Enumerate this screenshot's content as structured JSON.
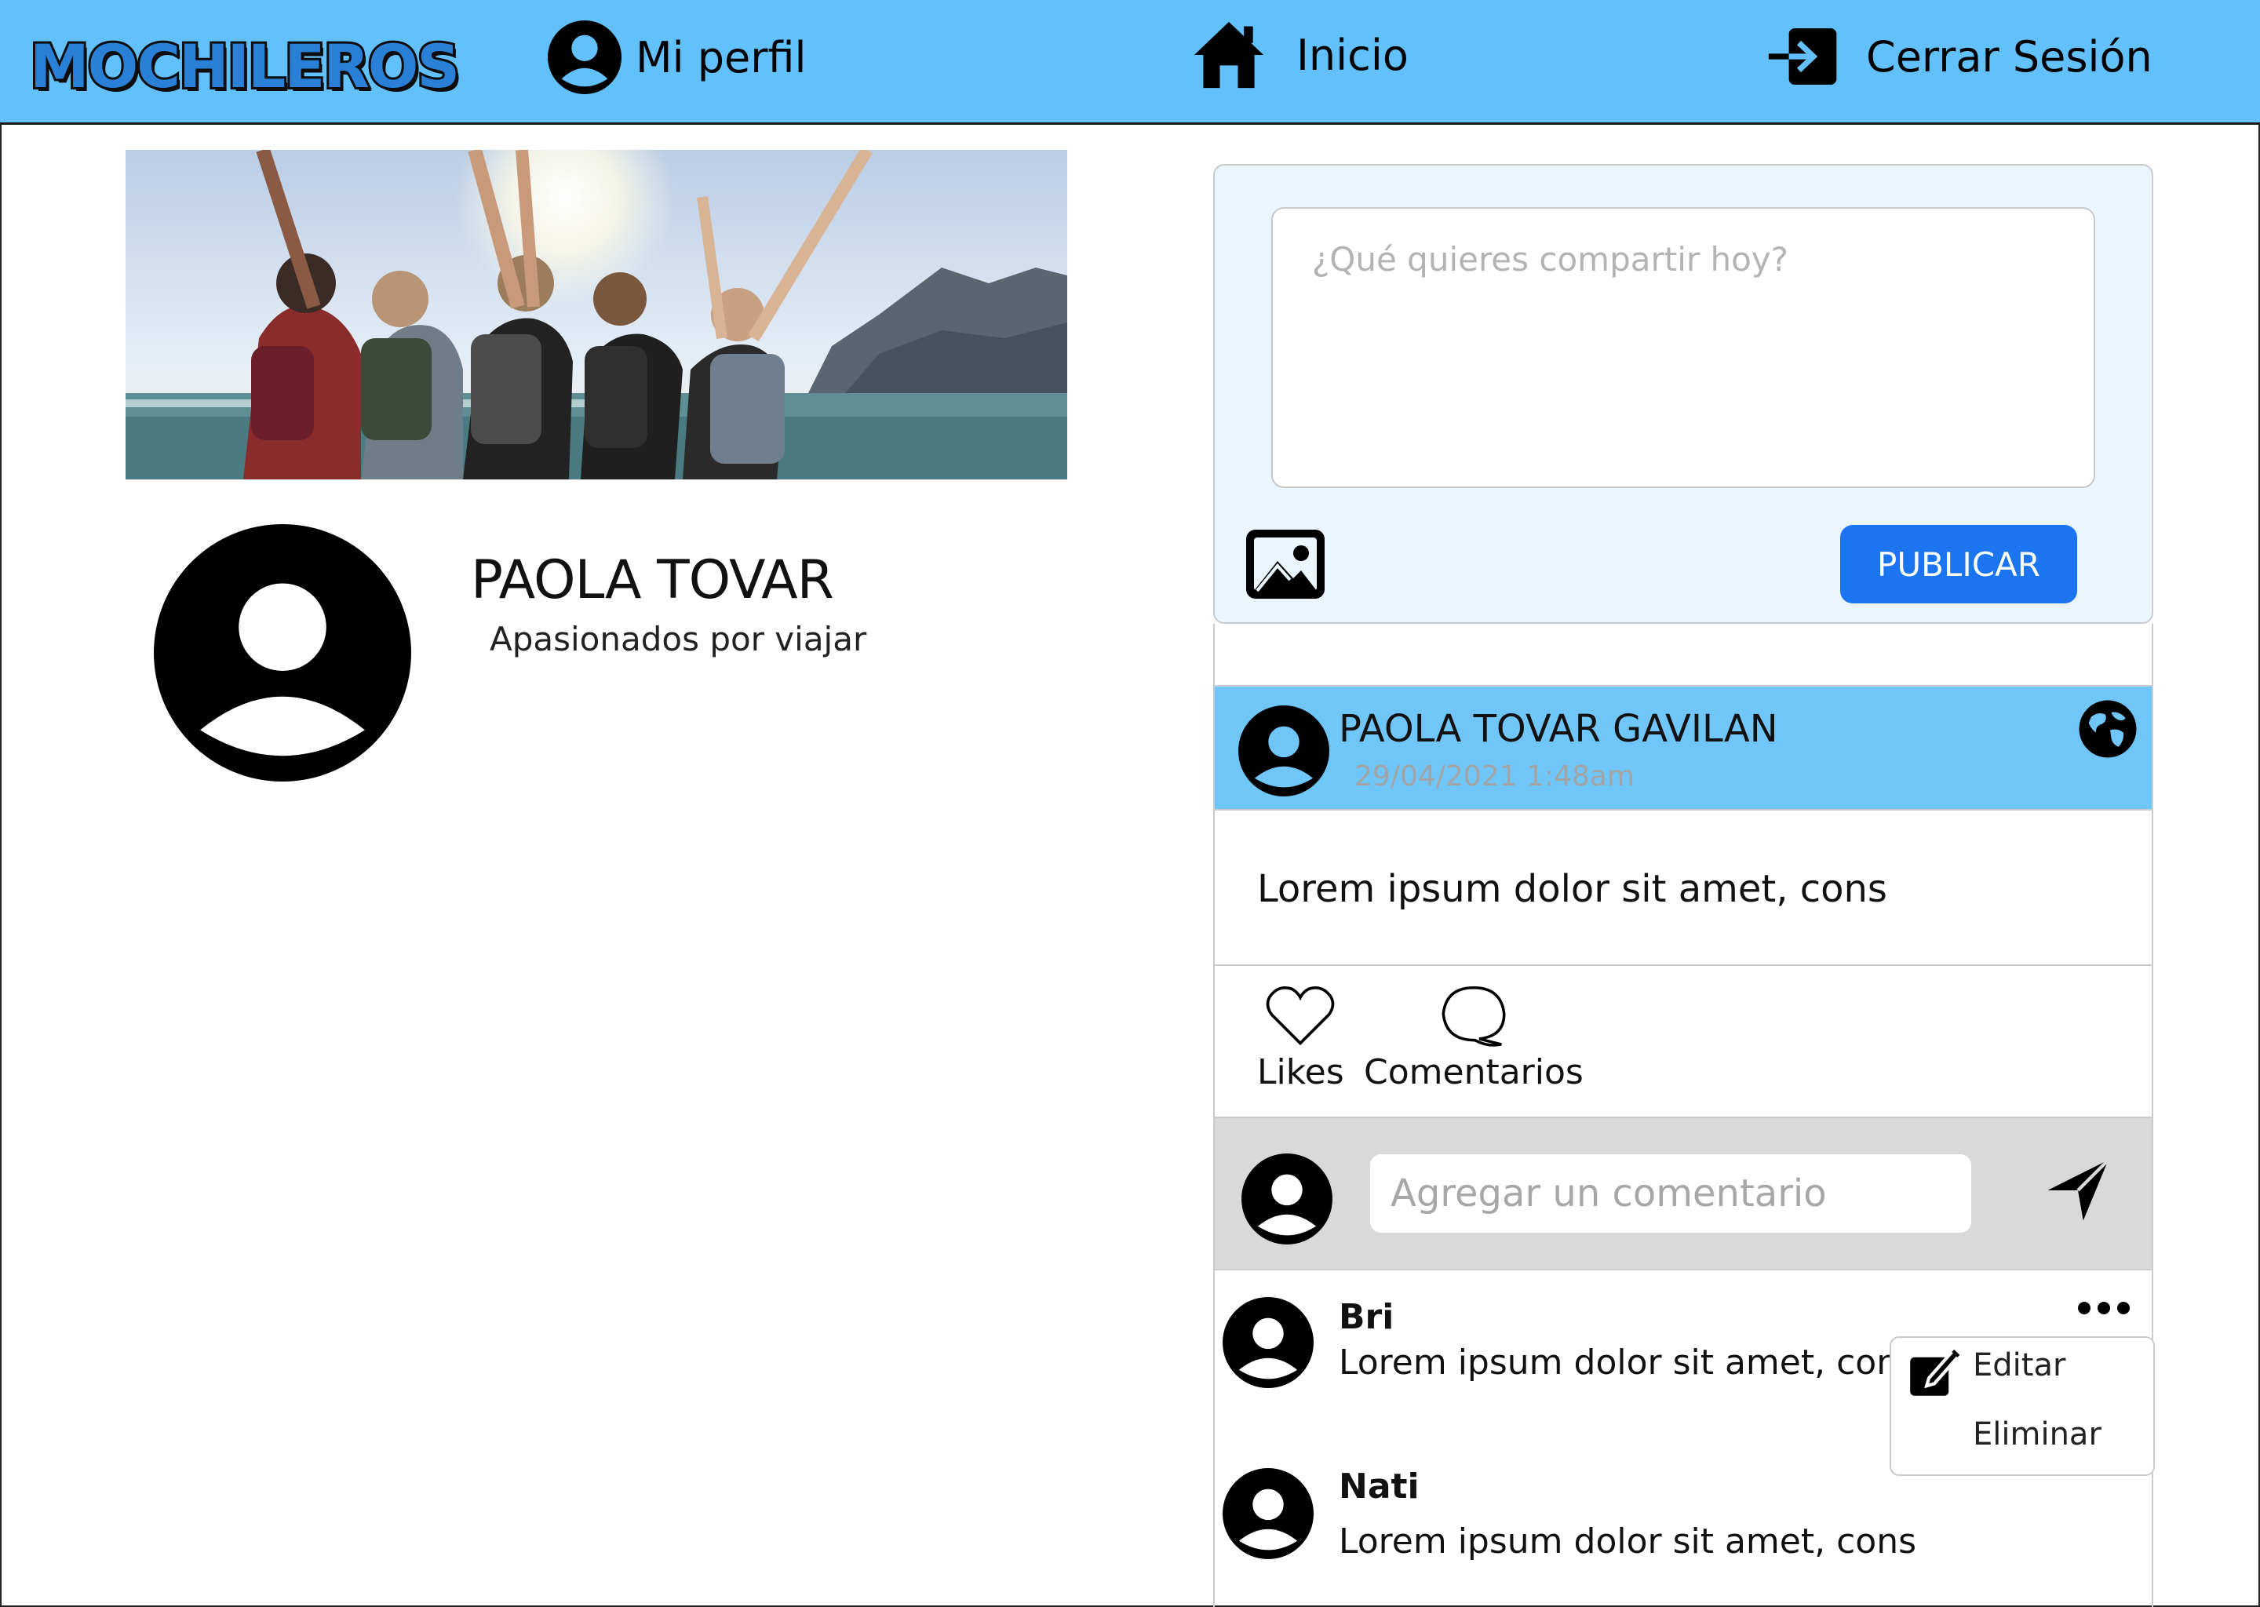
{
  "nav": {
    "logo": "MOCHILEROS",
    "profile_label": "Mi perfil",
    "home_label": "Inicio",
    "logout_label": "Cerrar Sesión",
    "icons": [
      "user-icon",
      "home-icon",
      "logout-icon"
    ],
    "background": "#62c0fa"
  },
  "profile": {
    "name": "PAOLA TOVAR",
    "bio": "Apasionados por viajar"
  },
  "composer": {
    "placeholder": "¿Qué quieres compartir hoy?",
    "publish_label": "PUBLICAR",
    "accent": "#1b75f0"
  },
  "post": {
    "author": "PAOLA TOVAR GAVILAN",
    "date": "29/04/2021 1:48am",
    "text": "Lorem ipsum dolor sit amet, cons",
    "likes_label": "Likes",
    "comments_label": "Comentarios",
    "header_color": "#70c6f9"
  },
  "comment_box": {
    "placeholder": "Agregar un comentario"
  },
  "comments": [
    {
      "author": "Bri",
      "text": "Lorem ipsum dolor sit amet, cons"
    },
    {
      "author": "Nati",
      "text": "Lorem ipsum dolor sit amet, cons"
    }
  ],
  "comment_menu": {
    "edit_label": "Editar",
    "delete_label": "Eliminar"
  }
}
